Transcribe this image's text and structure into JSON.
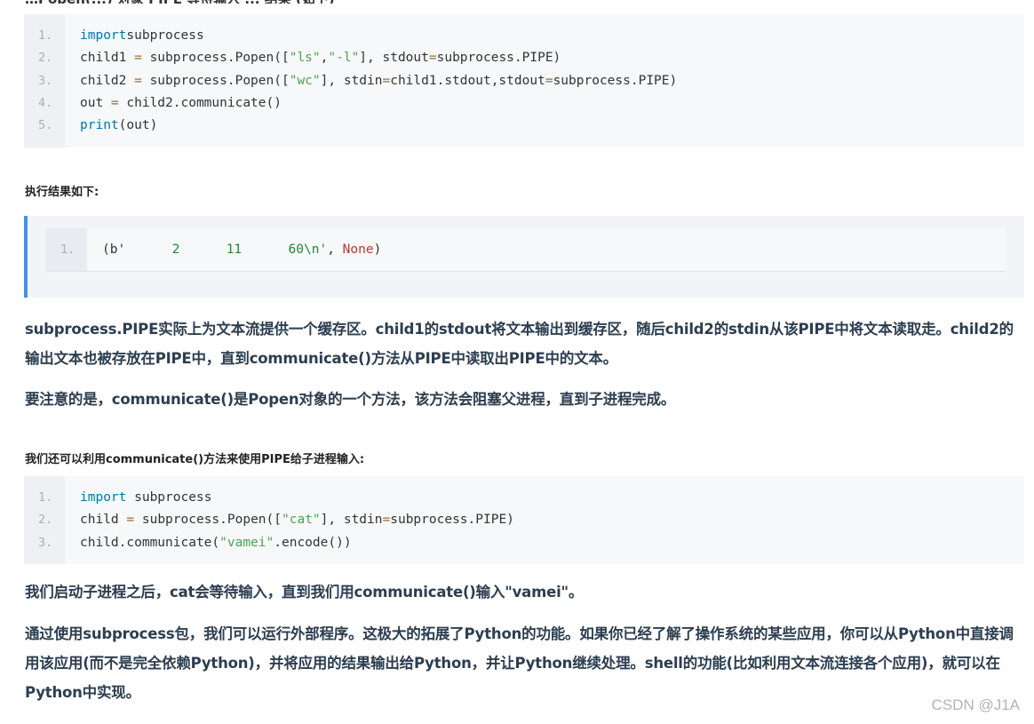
{
  "cut_top_text": "…Popen(...) 对象 PIPE 等待输入 ... 结果 (如下)",
  "code_block_1": {
    "lines": [
      {
        "num": "1.",
        "parts": [
          [
            "kw",
            "import"
          ],
          [
            "",
            "subprocess"
          ]
        ]
      },
      {
        "num": "2.",
        "parts": [
          [
            "",
            "child1 "
          ],
          [
            "op",
            "="
          ],
          [
            "",
            " subprocess.Popen(["
          ],
          [
            "str",
            "\"ls\""
          ],
          [
            "",
            ","
          ],
          [
            "str",
            "\"-l\""
          ],
          [
            "",
            "], stdout"
          ],
          [
            "op",
            "="
          ],
          [
            "",
            "subprocess.PIPE)"
          ]
        ]
      },
      {
        "num": "3.",
        "parts": [
          [
            "",
            "child2 "
          ],
          [
            "op",
            "="
          ],
          [
            "",
            " subprocess.Popen(["
          ],
          [
            "str",
            "\"wc\""
          ],
          [
            "",
            "], stdin"
          ],
          [
            "op",
            "="
          ],
          [
            "",
            "child1.stdout,stdout"
          ],
          [
            "op",
            "="
          ],
          [
            "",
            "subprocess.PIPE)"
          ]
        ]
      },
      {
        "num": "4.",
        "parts": [
          [
            "",
            "out "
          ],
          [
            "op",
            "="
          ],
          [
            "",
            " child2.communicate()"
          ]
        ]
      },
      {
        "num": "5.",
        "parts": [
          [
            "kw",
            "print"
          ],
          [
            "",
            "(out)"
          ]
        ]
      }
    ]
  },
  "heading_result": "执行结果如下:",
  "result_block": {
    "num": "1.",
    "parts": [
      [
        "",
        "(b'"
      ],
      [
        "num",
        "      2      11      60\\n'"
      ],
      [
        "",
        ", "
      ],
      [
        "con",
        "None"
      ],
      [
        "",
        ")"
      ]
    ]
  },
  "para_1": "subprocess.PIPE实际上为文本流提供一个缓存区。child1的stdout将文本输出到缓存区，随后child2的stdin从该PIPE中将文本读取走。child2的输出文本也被存放在PIPE中，直到communicate()方法从PIPE中读取出PIPE中的文本。",
  "para_2": "要注意的是，communicate()是Popen对象的一个方法，该方法会阻塞父进程，直到子进程完成。",
  "heading_communicate": "我们还可以利用communicate()方法来使用PIPE给子进程输入:",
  "code_block_2": {
    "lines": [
      {
        "num": "1.",
        "parts": [
          [
            "kw",
            "import"
          ],
          [
            "",
            " subprocess"
          ]
        ]
      },
      {
        "num": "2.",
        "parts": [
          [
            "",
            "child "
          ],
          [
            "op",
            "="
          ],
          [
            "",
            " subprocess.Popen(["
          ],
          [
            "str",
            "\"cat\""
          ],
          [
            "",
            "], stdin"
          ],
          [
            "op",
            "="
          ],
          [
            "",
            "subprocess.PIPE)"
          ]
        ]
      },
      {
        "num": "3.",
        "parts": [
          [
            "",
            "child.communicate("
          ],
          [
            "str",
            "\"vamei\""
          ],
          [
            "",
            ".encode())"
          ]
        ]
      }
    ]
  },
  "para_3": "我们启动子进程之后，cat会等待输入，直到我们用communicate()输入\"vamei\"。",
  "para_4": "通过使用subprocess包，我们可以运行外部程序。这极大的拓展了Python的功能。如果你已经了解了操作系统的某些应用，你可以从Python中直接调用该应用(而不是完全依赖Python)，并将应用的结果输出给Python，并让Python继续处理。shell的功能(比如利用文本流连接各个应用)，就可以在Python中实现。",
  "watermark": "CSDN @J1A"
}
